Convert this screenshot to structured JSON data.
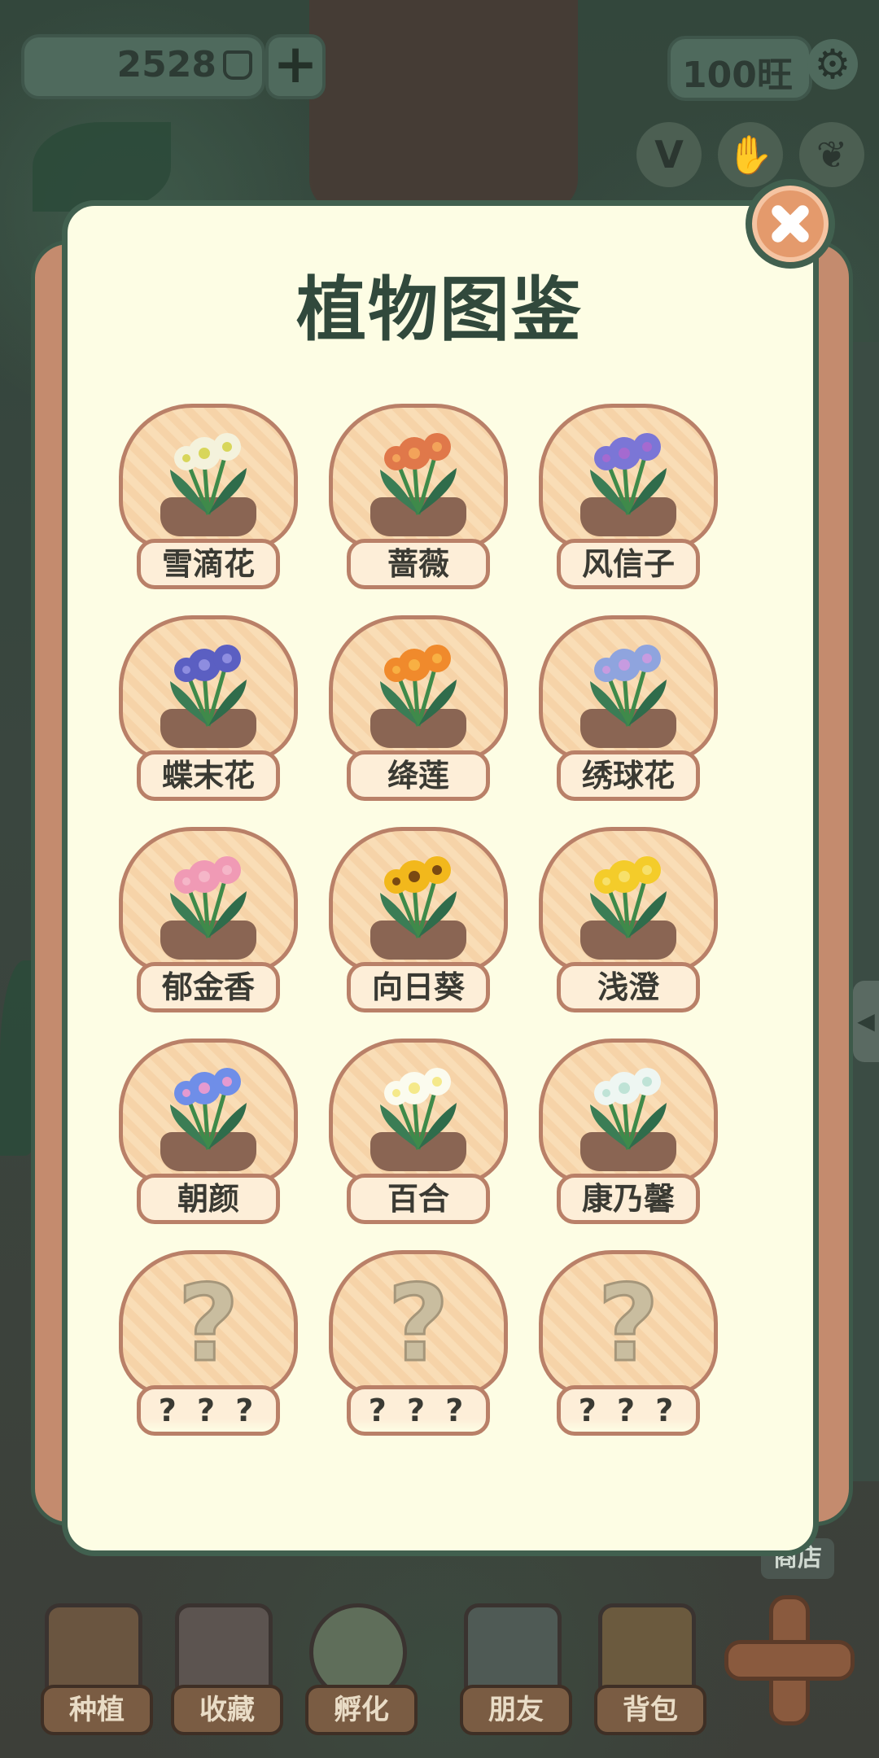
{
  "hud": {
    "coins": "2528",
    "plus": "+",
    "wang": "100旺",
    "settings_icon": "gear-icon",
    "quick_icons": [
      "v-badge-icon",
      "hand-icon",
      "ginkgo-leaf-icon"
    ]
  },
  "modal": {
    "title": "植物图鉴",
    "close_icon": "close-icon"
  },
  "plants": [
    {
      "name": "雪滴花",
      "unlocked": true,
      "petal": "#f4f2dc",
      "accent": "#d8d65a"
    },
    {
      "name": "蔷薇",
      "unlocked": true,
      "petal": "#e0784a",
      "accent": "#f3a35a"
    },
    {
      "name": "风信子",
      "unlocked": true,
      "petal": "#7b76d6",
      "accent": "#a56ad0"
    },
    {
      "name": "蝶末花",
      "unlocked": true,
      "petal": "#5b5fc2",
      "accent": "#8e8de0"
    },
    {
      "name": "绛莲",
      "unlocked": true,
      "petal": "#f08a2c",
      "accent": "#f8b043"
    },
    {
      "name": "绣球花",
      "unlocked": true,
      "petal": "#8fa4de",
      "accent": "#c79be0"
    },
    {
      "name": "郁金香",
      "unlocked": true,
      "petal": "#f09ab5",
      "accent": "#f5b6c8"
    },
    {
      "name": "向日葵",
      "unlocked": true,
      "petal": "#f2b81c",
      "accent": "#7a4a12"
    },
    {
      "name": "浅澄",
      "unlocked": true,
      "petal": "#f4cc2a",
      "accent": "#f7e06a"
    },
    {
      "name": "朝颜",
      "unlocked": true,
      "petal": "#6f8ee8",
      "accent": "#e49ad0"
    },
    {
      "name": "百合",
      "unlocked": true,
      "petal": "#fbfbee",
      "accent": "#f5e98a"
    },
    {
      "name": "康乃馨",
      "unlocked": true,
      "petal": "#eef6f2",
      "accent": "#bfe3d6"
    },
    {
      "name": "? ? ?",
      "unlocked": false
    },
    {
      "name": "? ? ?",
      "unlocked": false
    },
    {
      "name": "? ? ?",
      "unlocked": false
    }
  ],
  "bottom_nav": [
    {
      "label": "种植",
      "icon": "seedling-pot-icon"
    },
    {
      "label": "收藏",
      "icon": "shelf-icon"
    },
    {
      "label": "孵化",
      "icon": "egg-icon"
    },
    {
      "label": "朋友",
      "icon": "cat-face-icon"
    },
    {
      "label": "背包",
      "icon": "basket-icon"
    }
  ],
  "side": {
    "shop": "商店",
    "edge_arrow": "◀"
  }
}
